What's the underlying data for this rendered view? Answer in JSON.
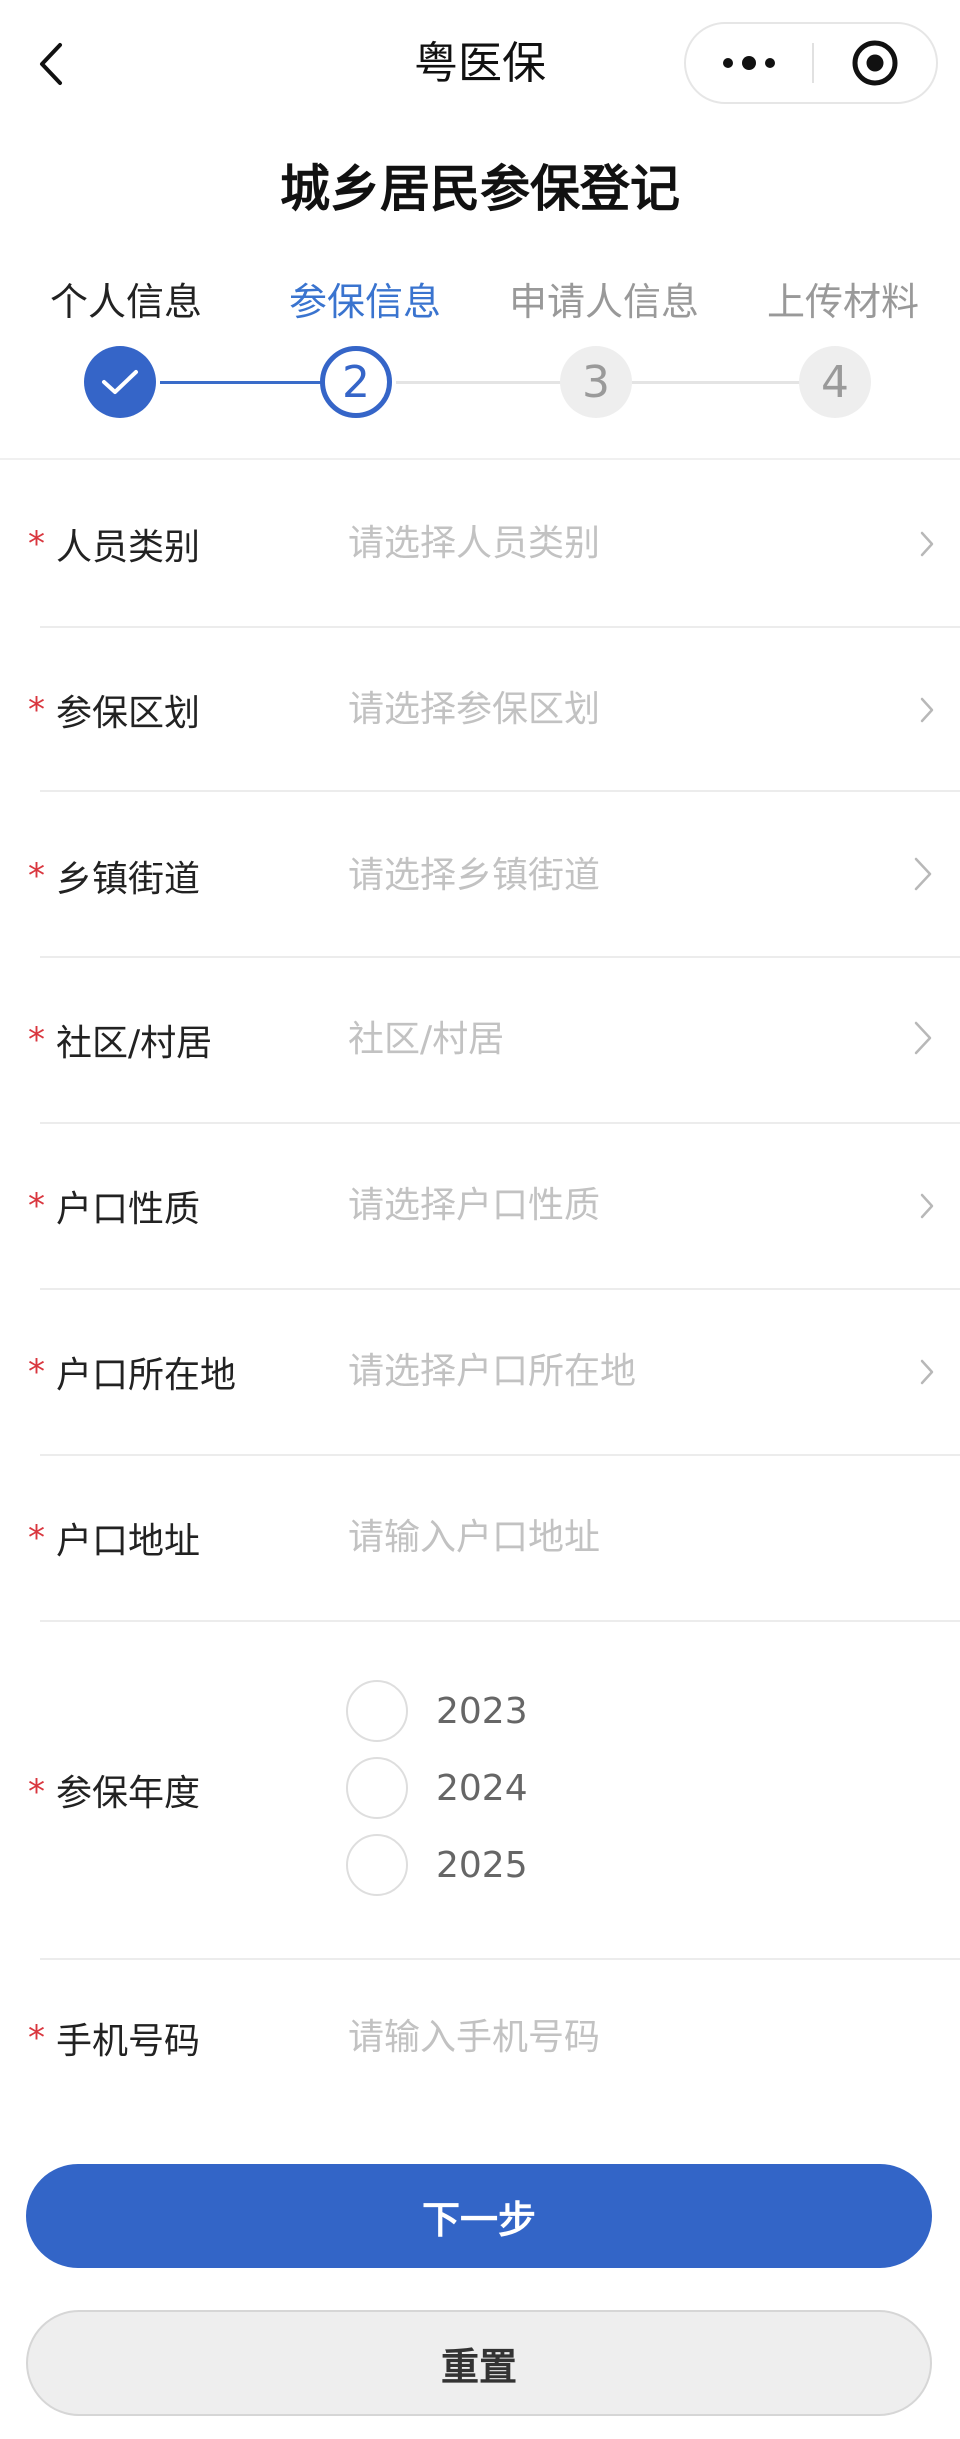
{
  "nav": {
    "title": "粤医保",
    "back_icon": "chevron-left-icon",
    "more_icon": "more-dots-icon",
    "close_icon": "target-circle-icon"
  },
  "page_title": "城乡居民参保登记",
  "stepper": {
    "active_color": "#3565c8",
    "steps": [
      {
        "label": "个人信息",
        "state": "done",
        "marker": "check-icon"
      },
      {
        "label": "参保信息",
        "state": "active",
        "number": "2"
      },
      {
        "label": "申请人信息",
        "state": "pending",
        "number": "3"
      },
      {
        "label": "上传材料",
        "state": "pending",
        "number": "4"
      }
    ]
  },
  "form": {
    "required_mark": "*",
    "fields": [
      {
        "label": "人员类别",
        "placeholder": "请选择人员类别",
        "type": "select"
      },
      {
        "label": "参保区划",
        "placeholder": "请选择参保区划",
        "type": "select"
      },
      {
        "label": "乡镇街道",
        "placeholder": "请选择乡镇街道",
        "type": "select"
      },
      {
        "label": "社区/村居",
        "placeholder": "社区/村居",
        "type": "select"
      },
      {
        "label": "户口性质",
        "placeholder": "请选择户口性质",
        "type": "select"
      },
      {
        "label": "户口所在地",
        "placeholder": "请选择户口所在地",
        "type": "select"
      },
      {
        "label": "户口地址",
        "placeholder": "请输入户口地址",
        "type": "input"
      }
    ],
    "year": {
      "label": "参保年度",
      "options": [
        "2023",
        "2024",
        "2025"
      ]
    },
    "phone": {
      "label": "手机号码",
      "placeholder": "请输入手机号码"
    }
  },
  "buttons": {
    "next": "下一步",
    "reset": "重置"
  },
  "colors": {
    "primary": "#3365c7",
    "required": "#d9363e",
    "placeholder": "#c2c2c2"
  }
}
